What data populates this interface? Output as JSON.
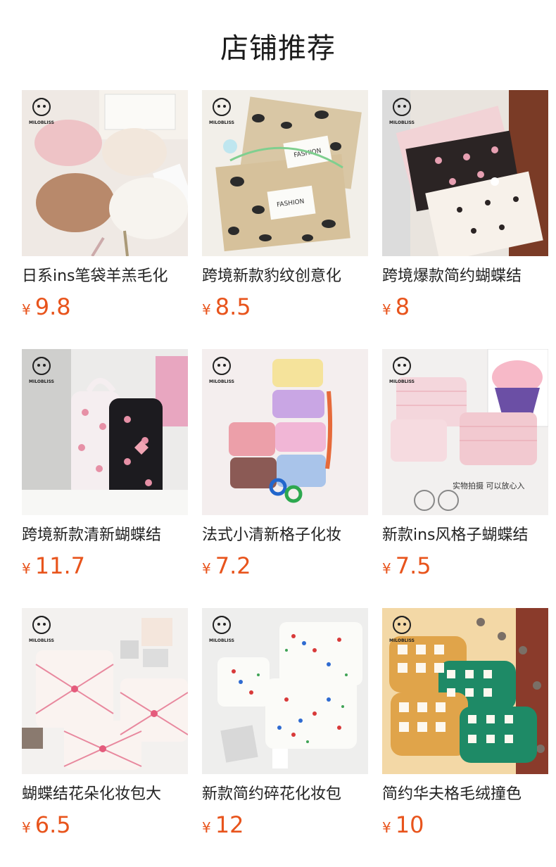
{
  "page": {
    "title": "店铺推荐"
  },
  "brand": {
    "logo_text": "MILOBLISS"
  },
  "currency": "¥",
  "accent_color": "#e8541c",
  "products": [
    {
      "name": "日系ins笔袋羊羔毛化",
      "price": "9.8"
    },
    {
      "name": "跨境新款豹纹创意化",
      "price": "8.5"
    },
    {
      "name": "跨境爆款简约蝴蝶结",
      "price": "8"
    },
    {
      "name": "跨境新款清新蝴蝶结",
      "price": "11.7"
    },
    {
      "name": "法式小清新格子化妆",
      "price": "7.2"
    },
    {
      "name": "新款ins风格子蝴蝶结",
      "price": "7.5"
    },
    {
      "name": "蝴蝶结花朵化妆包大",
      "price": "6.5"
    },
    {
      "name": "新款简约碎花化妆包",
      "price": "12"
    },
    {
      "name": "简约华夫格毛绒撞色",
      "price": "10"
    }
  ],
  "image_text": {
    "p2_label1": "FASHION",
    "p2_label2": "FASHION",
    "p6_caption": "实物拍摄 可以放心入"
  }
}
